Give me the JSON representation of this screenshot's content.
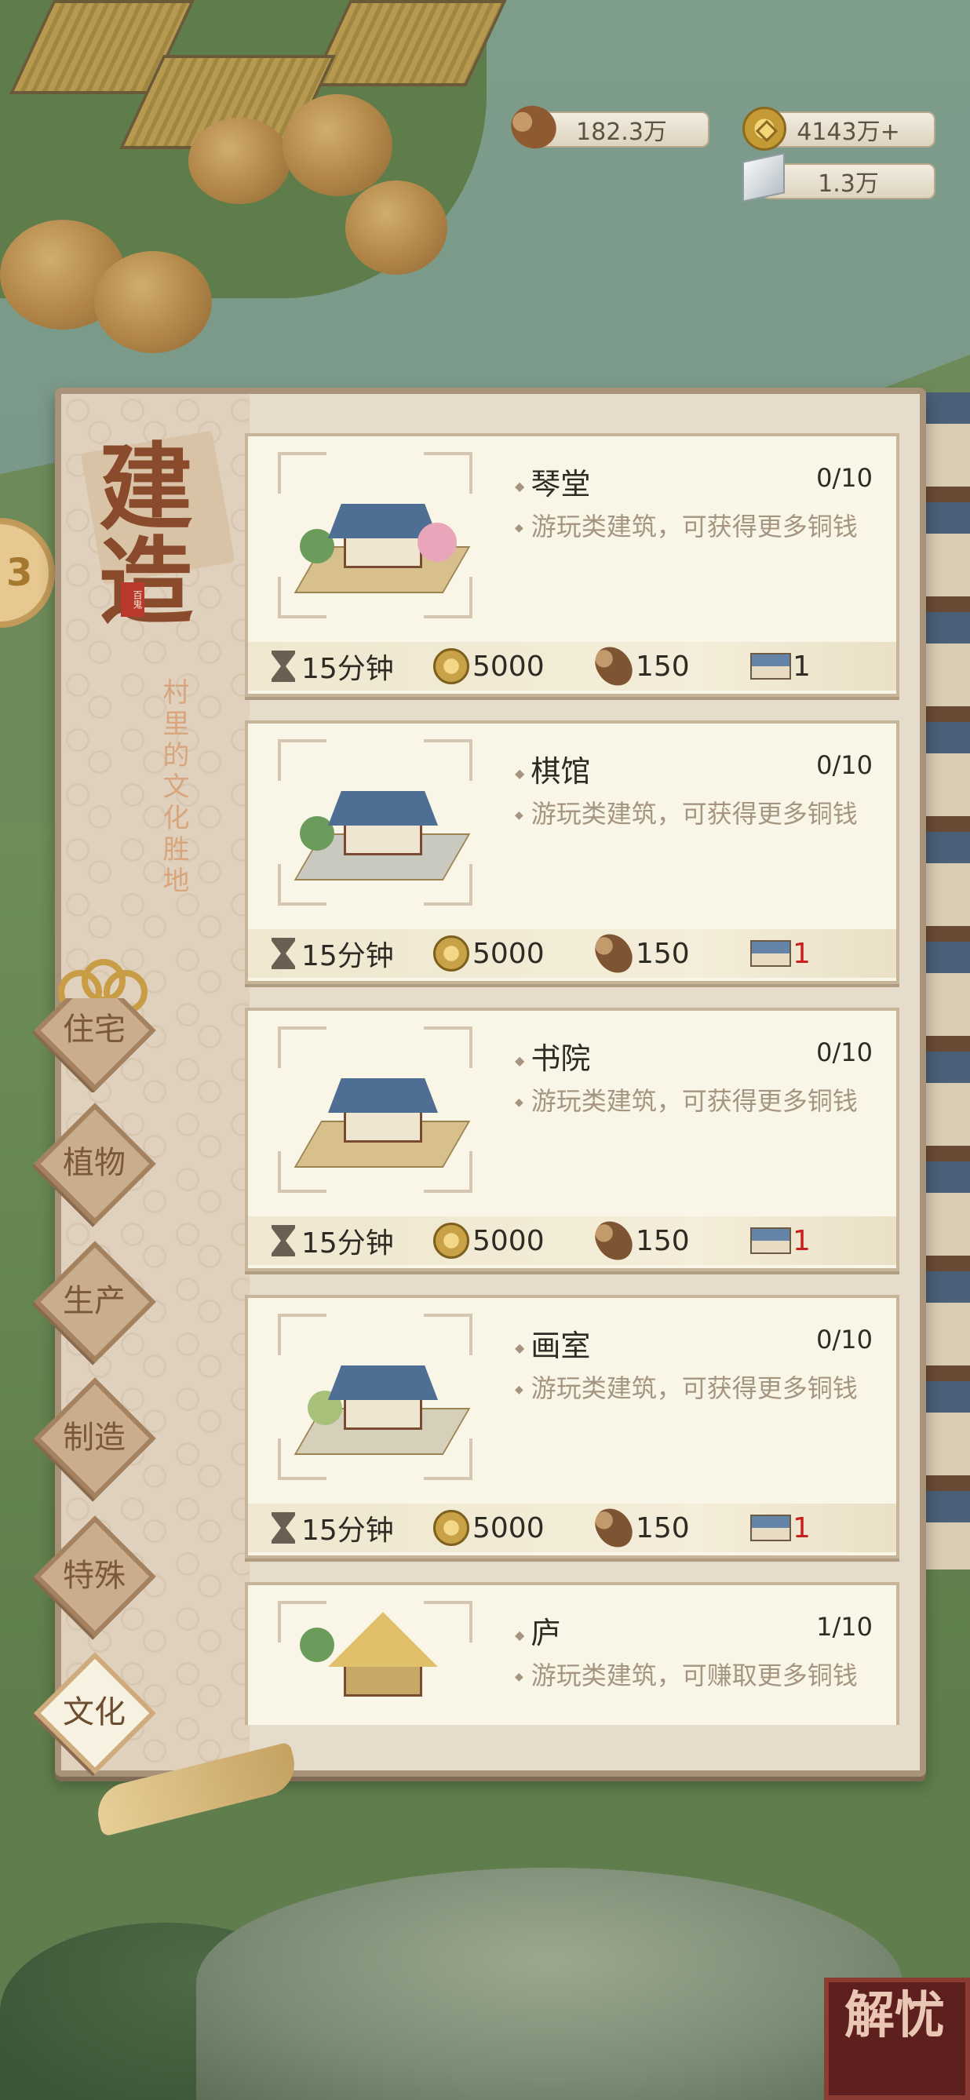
{
  "resources": {
    "wood": {
      "icon": "wood-log-icon",
      "value": "182.3万"
    },
    "coins": {
      "icon": "copper-coin-icon",
      "value": "4143万+"
    },
    "stone": {
      "icon": "stone-block-icon",
      "value": "1.3万"
    }
  },
  "panel": {
    "title": "建造",
    "stamp": "百鬼",
    "subtitle": "村里的文化胜地"
  },
  "tabs": [
    {
      "label": "住宅",
      "active": false
    },
    {
      "label": "植物",
      "active": false
    },
    {
      "label": "生产",
      "active": false
    },
    {
      "label": "制造",
      "active": false
    },
    {
      "label": "特殊",
      "active": false
    },
    {
      "label": "文化",
      "active": true
    }
  ],
  "buildings": [
    {
      "name": "琴堂",
      "count": "0/10",
      "desc": "游玩类建筑，可获得更多铜钱",
      "time": "15分钟",
      "coin": "5000",
      "wood": "150",
      "house": "1",
      "house_short": false
    },
    {
      "name": "棋馆",
      "count": "0/10",
      "desc": "游玩类建筑，可获得更多铜钱",
      "time": "15分钟",
      "coin": "5000",
      "wood": "150",
      "house": "1",
      "house_short": true
    },
    {
      "name": "书院",
      "count": "0/10",
      "desc": "游玩类建筑，可获得更多铜钱",
      "time": "15分钟",
      "coin": "5000",
      "wood": "150",
      "house": "1",
      "house_short": true
    },
    {
      "name": "画室",
      "count": "0/10",
      "desc": "游玩类建筑，可获得更多铜钱",
      "time": "15分钟",
      "coin": "5000",
      "wood": "150",
      "house": "1",
      "house_short": true
    },
    {
      "name": "庐",
      "count": "1/10",
      "desc": "游玩类建筑，可赚取更多铜钱"
    }
  ],
  "corner_button": "解忧",
  "colors": {
    "accent_red": "#c9211e",
    "card_bg": "#faf6e7",
    "panel_bg": "#e6dccb",
    "tab_label": "#7a5838"
  }
}
